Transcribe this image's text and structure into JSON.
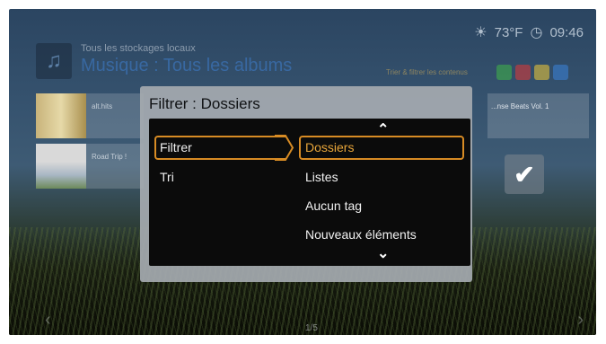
{
  "status": {
    "temperature": "73°F",
    "time": "09:46"
  },
  "header": {
    "subtitle": "Tous les stockages locaux",
    "title": "Musique : Tous les albums"
  },
  "hint": "Trier & filtrer les contenus",
  "chip_colors": [
    "#3fae4a",
    "#d23a3a",
    "#e3c13a",
    "#3a7fd2"
  ],
  "rows": [
    {
      "label": "alt.hits"
    },
    {
      "label": "Road Trip !"
    }
  ],
  "right_row": {
    "label": "...nse Beats Vol. 1"
  },
  "pager": "1/5",
  "dialog": {
    "title": "Filtrer : Dossiers",
    "left_items": [
      "Filtrer",
      "Tri"
    ],
    "right_items": [
      "Dossiers",
      "Listes",
      "Aucun tag",
      "Nouveaux éléments"
    ]
  },
  "colors": {
    "selection": "#d78b24",
    "dialog": "#a5aab0",
    "panel": "#0b0b0b"
  }
}
